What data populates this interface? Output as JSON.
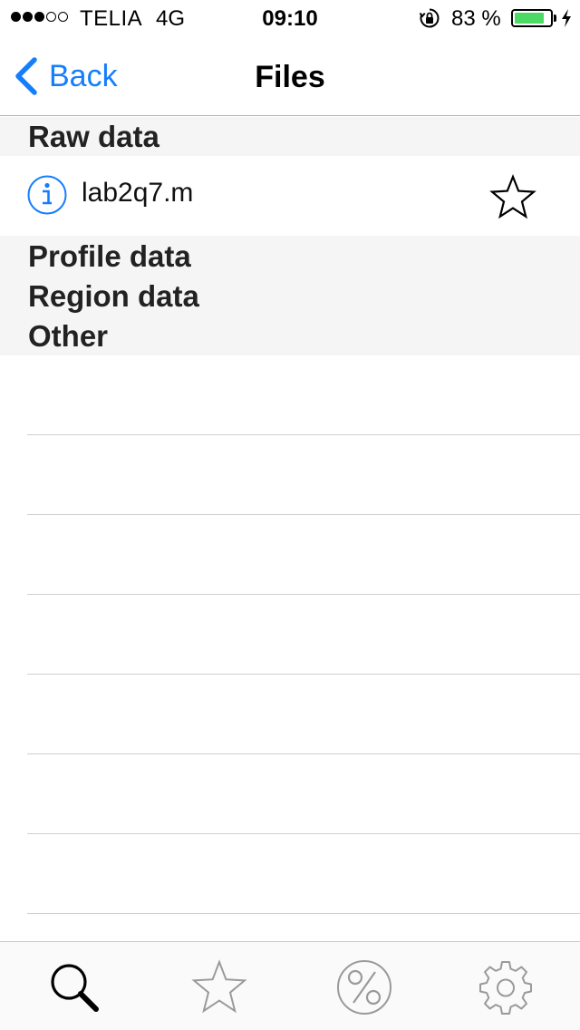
{
  "status_bar": {
    "signal_filled": 3,
    "signal_total": 5,
    "carrier": "TELIA",
    "network": "4G",
    "time": "09:10",
    "battery_percent": "83 %",
    "battery_level": 0.83,
    "battery_color": "#4cd964"
  },
  "nav": {
    "back_label": "Back",
    "back_icon": "chevron-left-icon",
    "title": "Files",
    "accent_color": "#157efb"
  },
  "sections": [
    {
      "title": "Raw data",
      "files": [
        {
          "name": "lab2q7.m",
          "info_icon": "info-icon",
          "favorite_icon": "star-outline-icon",
          "favorited": false
        }
      ]
    },
    {
      "title": "Profile data",
      "files": []
    },
    {
      "title": "Region data",
      "files": []
    },
    {
      "title": "Other",
      "files": []
    }
  ],
  "tab_bar": {
    "tabs": [
      {
        "name": "search",
        "icon": "search-icon",
        "selected": true
      },
      {
        "name": "favorites",
        "icon": "star-icon",
        "selected": false
      },
      {
        "name": "percent",
        "icon": "percent-icon",
        "selected": false
      },
      {
        "name": "settings",
        "icon": "gear-icon",
        "selected": false
      }
    ]
  }
}
